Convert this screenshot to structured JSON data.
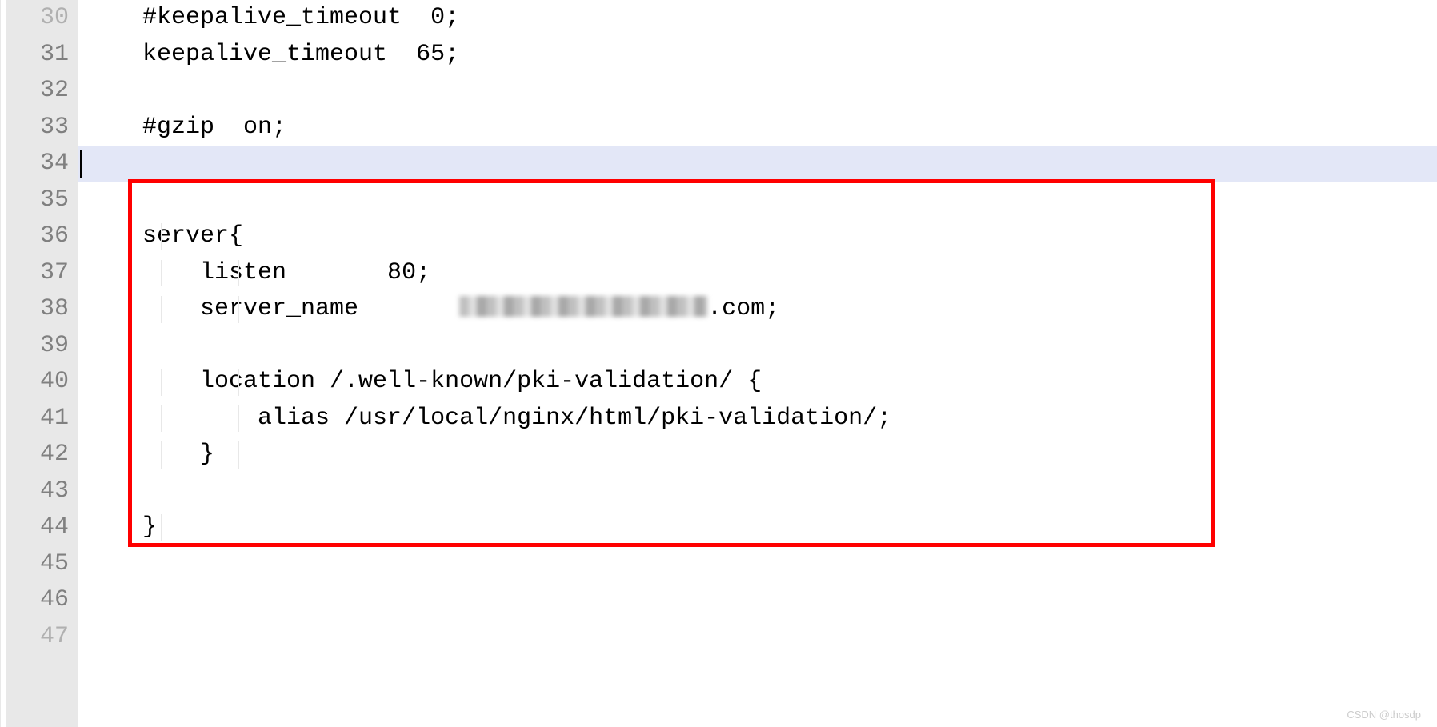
{
  "gutter": {
    "start": 30,
    "end": 47,
    "current": 34
  },
  "code": {
    "l30": "    #keepalive_timeout  0;",
    "l31": "    keepalive_timeout  65;",
    "l32": "",
    "l33": "    #gzip  on;",
    "l34": "",
    "l35": "",
    "l36": "    server{",
    "l37": "        listen       80;",
    "l38_pre": "        server_name       ",
    "l38_post": ".com;",
    "l39": "",
    "l40": "        location /.well-known/pki-validation/ {",
    "l41": "            alias /usr/local/nginx/html/pki-validation/;",
    "l42": "        }",
    "l43": "",
    "l44": "    }",
    "l45": "",
    "l46": "",
    "l47": ""
  },
  "watermark": "CSDN @thosdp"
}
